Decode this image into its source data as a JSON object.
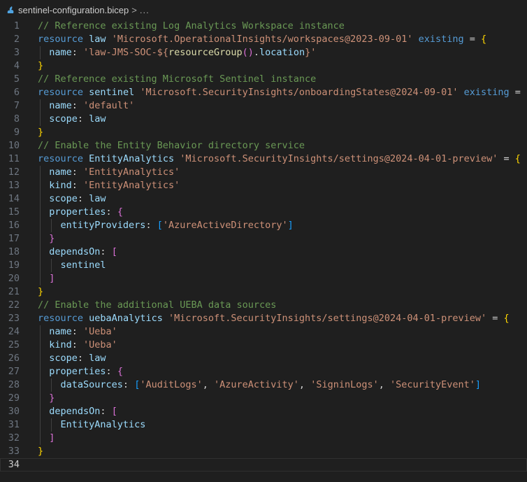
{
  "breadcrumb": {
    "file_name": "sentinel-configuration.bicep",
    "separator": ">",
    "more": "..."
  },
  "colors": {
    "background": "#1f1f1f",
    "keyword": "#569cd6",
    "identifier": "#9cdcfe",
    "string": "#ce9178",
    "comment": "#6a9955",
    "bracket_level1": "#ffd700",
    "bracket_level2": "#da70d6",
    "bracket_level3": "#179fff",
    "function": "#dcdcaa",
    "line_number": "#6e7681"
  },
  "editor": {
    "current_line": 34,
    "lines": [
      {
        "n": "1",
        "guides": 0,
        "tokens": [
          [
            "c",
            "// Reference existing Log Analytics Workspace instance"
          ]
        ]
      },
      {
        "n": "2",
        "guides": 0,
        "tokens": [
          [
            "k",
            "resource"
          ],
          [
            "p",
            " "
          ],
          [
            "v",
            "law"
          ],
          [
            "p",
            " "
          ],
          [
            "s",
            "'Microsoft.OperationalInsights/workspaces@2023-09-01'"
          ],
          [
            "p",
            " "
          ],
          [
            "k",
            "existing"
          ],
          [
            "p",
            " = "
          ],
          [
            "b1",
            "{"
          ]
        ]
      },
      {
        "n": "3",
        "guides": 1,
        "tokens": [
          [
            "p",
            "  "
          ],
          [
            "v",
            "name"
          ],
          [
            "p",
            ": "
          ],
          [
            "s",
            "'law-JMS-SOC-${"
          ],
          [
            "fn",
            "resourceGroup"
          ],
          [
            "b2",
            "()"
          ],
          [
            "p",
            "."
          ],
          [
            "v",
            "location"
          ],
          [
            "s",
            "}'"
          ]
        ]
      },
      {
        "n": "4",
        "guides": 0,
        "tokens": [
          [
            "b1",
            "}"
          ]
        ]
      },
      {
        "n": "5",
        "guides": 0,
        "tokens": [
          [
            "c",
            "// Reference existing Microsoft Sentinel instance"
          ]
        ]
      },
      {
        "n": "6",
        "guides": 0,
        "tokens": [
          [
            "k",
            "resource"
          ],
          [
            "p",
            " "
          ],
          [
            "v",
            "sentinel"
          ],
          [
            "p",
            " "
          ],
          [
            "s",
            "'Microsoft.SecurityInsights/onboardingStates@2024-09-01'"
          ],
          [
            "p",
            " "
          ],
          [
            "k",
            "existing"
          ],
          [
            "p",
            " = "
          ],
          [
            "b1",
            "{"
          ]
        ]
      },
      {
        "n": "7",
        "guides": 1,
        "tokens": [
          [
            "p",
            "  "
          ],
          [
            "v",
            "name"
          ],
          [
            "p",
            ": "
          ],
          [
            "s",
            "'default'"
          ]
        ]
      },
      {
        "n": "8",
        "guides": 1,
        "tokens": [
          [
            "p",
            "  "
          ],
          [
            "v",
            "scope"
          ],
          [
            "p",
            ": "
          ],
          [
            "v",
            "law"
          ]
        ]
      },
      {
        "n": "9",
        "guides": 0,
        "tokens": [
          [
            "b1",
            "}"
          ]
        ]
      },
      {
        "n": "10",
        "guides": 0,
        "tokens": [
          [
            "c",
            "// Enable the Entity Behavior directory service"
          ]
        ]
      },
      {
        "n": "11",
        "guides": 0,
        "tokens": [
          [
            "k",
            "resource"
          ],
          [
            "p",
            " "
          ],
          [
            "v",
            "EntityAnalytics"
          ],
          [
            "p",
            " "
          ],
          [
            "s",
            "'Microsoft.SecurityInsights/settings@2024-04-01-preview'"
          ],
          [
            "p",
            " = "
          ],
          [
            "b1",
            "{"
          ]
        ]
      },
      {
        "n": "12",
        "guides": 1,
        "tokens": [
          [
            "p",
            "  "
          ],
          [
            "v",
            "name"
          ],
          [
            "p",
            ": "
          ],
          [
            "s",
            "'EntityAnalytics'"
          ]
        ]
      },
      {
        "n": "13",
        "guides": 1,
        "tokens": [
          [
            "p",
            "  "
          ],
          [
            "v",
            "kind"
          ],
          [
            "p",
            ": "
          ],
          [
            "s",
            "'EntityAnalytics'"
          ]
        ]
      },
      {
        "n": "14",
        "guides": 1,
        "tokens": [
          [
            "p",
            "  "
          ],
          [
            "v",
            "scope"
          ],
          [
            "p",
            ": "
          ],
          [
            "v",
            "law"
          ]
        ]
      },
      {
        "n": "15",
        "guides": 1,
        "tokens": [
          [
            "p",
            "  "
          ],
          [
            "v",
            "properties"
          ],
          [
            "p",
            ": "
          ],
          [
            "b2",
            "{"
          ]
        ]
      },
      {
        "n": "16",
        "guides": 2,
        "tokens": [
          [
            "p",
            "    "
          ],
          [
            "v",
            "entityProviders"
          ],
          [
            "p",
            ": "
          ],
          [
            "b3",
            "["
          ],
          [
            "s",
            "'AzureActiveDirectory'"
          ],
          [
            "b3",
            "]"
          ]
        ]
      },
      {
        "n": "17",
        "guides": 1,
        "tokens": [
          [
            "p",
            "  "
          ],
          [
            "b2",
            "}"
          ]
        ]
      },
      {
        "n": "18",
        "guides": 1,
        "tokens": [
          [
            "p",
            "  "
          ],
          [
            "v",
            "dependsOn"
          ],
          [
            "p",
            ": "
          ],
          [
            "b2",
            "["
          ]
        ]
      },
      {
        "n": "19",
        "guides": 2,
        "tokens": [
          [
            "p",
            "    "
          ],
          [
            "v",
            "sentinel"
          ]
        ]
      },
      {
        "n": "20",
        "guides": 1,
        "tokens": [
          [
            "p",
            "  "
          ],
          [
            "b2",
            "]"
          ]
        ]
      },
      {
        "n": "21",
        "guides": 0,
        "tokens": [
          [
            "b1",
            "}"
          ]
        ]
      },
      {
        "n": "22",
        "guides": 0,
        "tokens": [
          [
            "c",
            "// Enable the additional UEBA data sources"
          ]
        ]
      },
      {
        "n": "23",
        "guides": 0,
        "tokens": [
          [
            "k",
            "resource"
          ],
          [
            "p",
            " "
          ],
          [
            "v",
            "uebaAnalytics"
          ],
          [
            "p",
            " "
          ],
          [
            "s",
            "'Microsoft.SecurityInsights/settings@2024-04-01-preview'"
          ],
          [
            "p",
            " = "
          ],
          [
            "b1",
            "{"
          ]
        ]
      },
      {
        "n": "24",
        "guides": 1,
        "tokens": [
          [
            "p",
            "  "
          ],
          [
            "v",
            "name"
          ],
          [
            "p",
            ": "
          ],
          [
            "s",
            "'Ueba'"
          ]
        ]
      },
      {
        "n": "25",
        "guides": 1,
        "tokens": [
          [
            "p",
            "  "
          ],
          [
            "v",
            "kind"
          ],
          [
            "p",
            ": "
          ],
          [
            "s",
            "'Ueba'"
          ]
        ]
      },
      {
        "n": "26",
        "guides": 1,
        "tokens": [
          [
            "p",
            "  "
          ],
          [
            "v",
            "scope"
          ],
          [
            "p",
            ": "
          ],
          [
            "v",
            "law"
          ]
        ]
      },
      {
        "n": "27",
        "guides": 1,
        "tokens": [
          [
            "p",
            "  "
          ],
          [
            "v",
            "properties"
          ],
          [
            "p",
            ": "
          ],
          [
            "b2",
            "{"
          ]
        ]
      },
      {
        "n": "28",
        "guides": 2,
        "tokens": [
          [
            "p",
            "    "
          ],
          [
            "v",
            "dataSources"
          ],
          [
            "p",
            ": "
          ],
          [
            "b3",
            "["
          ],
          [
            "s",
            "'AuditLogs'"
          ],
          [
            "p",
            ", "
          ],
          [
            "s",
            "'AzureActivity'"
          ],
          [
            "p",
            ", "
          ],
          [
            "s",
            "'SigninLogs'"
          ],
          [
            "p",
            ", "
          ],
          [
            "s",
            "'SecurityEvent'"
          ],
          [
            "b3",
            "]"
          ]
        ]
      },
      {
        "n": "29",
        "guides": 1,
        "tokens": [
          [
            "p",
            "  "
          ],
          [
            "b2",
            "}"
          ]
        ]
      },
      {
        "n": "30",
        "guides": 1,
        "tokens": [
          [
            "p",
            "  "
          ],
          [
            "v",
            "dependsOn"
          ],
          [
            "p",
            ": "
          ],
          [
            "b2",
            "["
          ]
        ]
      },
      {
        "n": "31",
        "guides": 2,
        "tokens": [
          [
            "p",
            "    "
          ],
          [
            "v",
            "EntityAnalytics"
          ]
        ]
      },
      {
        "n": "32",
        "guides": 1,
        "tokens": [
          [
            "p",
            "  "
          ],
          [
            "b2",
            "]"
          ]
        ]
      },
      {
        "n": "33",
        "guides": 0,
        "tokens": [
          [
            "b1",
            "}"
          ]
        ]
      },
      {
        "n": "34",
        "guides": 0,
        "tokens": []
      }
    ]
  }
}
